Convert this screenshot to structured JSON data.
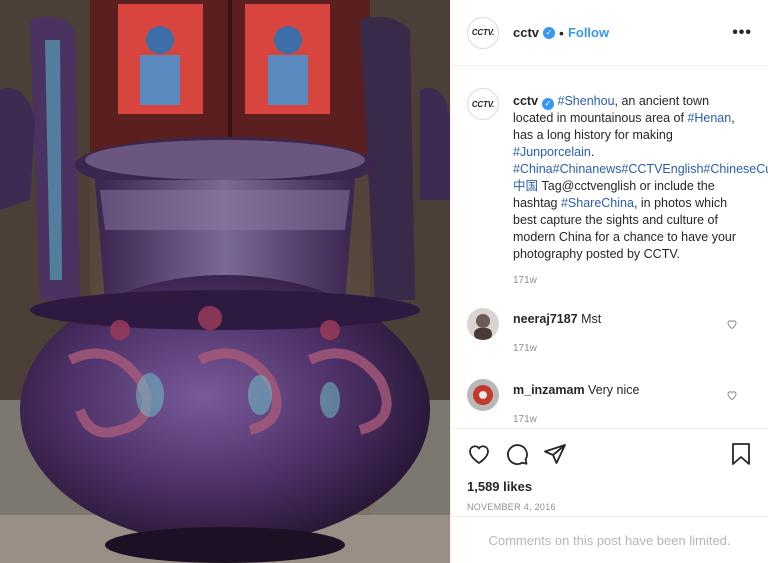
{
  "post": {
    "photo": {
      "description_icon": "porcelain-vessel-photo"
    },
    "header": {
      "avatar_logo": "CCTV.",
      "username": "cctv",
      "separator": "•",
      "follow_label": "Follow",
      "more_label": "•••"
    },
    "caption": {
      "username": "cctv",
      "segments": [
        {
          "text": " ",
          "tag": false
        },
        {
          "text": "#Shenhou",
          "tag": true
        },
        {
          "text": ", an ancient town located in mountainous area of ",
          "tag": false
        },
        {
          "text": "#Henan",
          "tag": true
        },
        {
          "text": ", has a long history for making ",
          "tag": false
        },
        {
          "text": "#Junporcelain",
          "tag": true
        },
        {
          "text": ". ",
          "tag": false
        },
        {
          "text": "#China",
          "tag": true
        },
        {
          "text": "#Chinanews",
          "tag": true
        },
        {
          "text": "#CCTVEnglish",
          "tag": true
        },
        {
          "text": "#ChineseCulture",
          "tag": true
        },
        {
          "text": "#中国",
          "tag": true
        },
        {
          "text": " Tag@cctvenglish or include the hashtag ",
          "tag": false
        },
        {
          "text": "#ShareChina",
          "tag": true
        },
        {
          "text": ", in photos which best capture the sights and culture of modern China for a chance to have your photography posted by CCTV.",
          "tag": false
        }
      ],
      "time": "171w"
    },
    "comments": [
      {
        "username": "neeraj7187",
        "text": "Mst",
        "time": "171w",
        "avatar_color": "#6b5a55"
      },
      {
        "username": "m_inzamam",
        "text": "Very nice",
        "time": "171w",
        "avatar_color": "#c0392b"
      }
    ],
    "likes": "1,589 likes",
    "date": "NOVEMBER 4, 2016",
    "limited_notice": "Comments on this post have been limited."
  }
}
